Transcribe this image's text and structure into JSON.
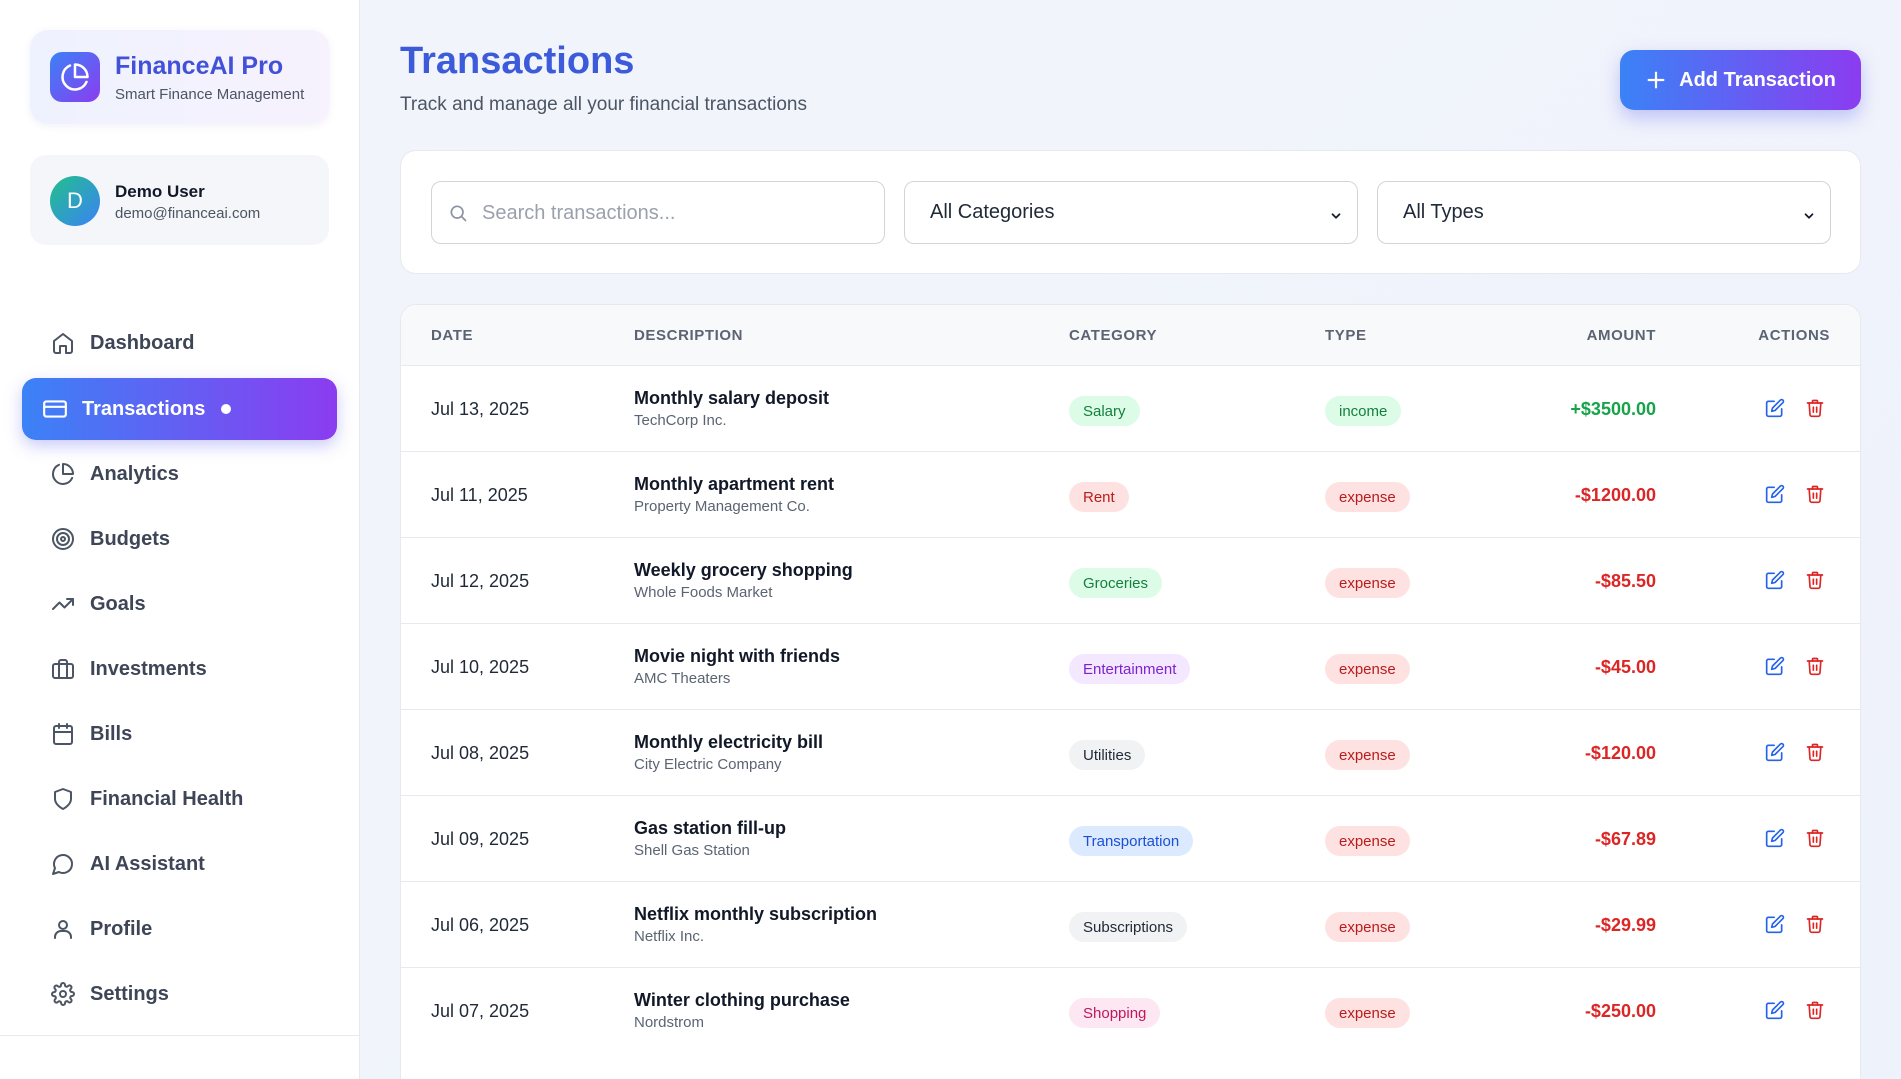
{
  "brand": {
    "title": "FinanceAI Pro",
    "subtitle": "Smart Finance Management"
  },
  "user": {
    "initial": "D",
    "name": "Demo User",
    "email": "demo@financeai.com"
  },
  "nav": [
    {
      "label": "Dashboard",
      "icon": "home-icon"
    },
    {
      "label": "Transactions",
      "icon": "credit-card-icon",
      "active": true
    },
    {
      "label": "Analytics",
      "icon": "pie-chart-icon"
    },
    {
      "label": "Budgets",
      "icon": "target-icon"
    },
    {
      "label": "Goals",
      "icon": "trending-up-icon"
    },
    {
      "label": "Investments",
      "icon": "briefcase-icon"
    },
    {
      "label": "Bills",
      "icon": "calendar-icon"
    },
    {
      "label": "Financial Health",
      "icon": "shield-icon"
    },
    {
      "label": "AI Assistant",
      "icon": "chat-bubble-icon"
    },
    {
      "label": "Profile",
      "icon": "user-icon"
    },
    {
      "label": "Settings",
      "icon": "gear-icon"
    }
  ],
  "header": {
    "title": "Transactions",
    "subtitle": "Track and manage all your financial transactions",
    "add_button": "Add Transaction"
  },
  "filters": {
    "search_placeholder": "Search transactions...",
    "category_selected": "All Categories",
    "type_selected": "All Types"
  },
  "table": {
    "columns": [
      "DATE",
      "DESCRIPTION",
      "CATEGORY",
      "TYPE",
      "AMOUNT",
      "ACTIONS"
    ],
    "rows": [
      {
        "date": "Jul 13, 2025",
        "description": "Monthly salary deposit",
        "merchant": "TechCorp Inc.",
        "category": "Salary",
        "type": "income",
        "amount": "+$3500.00"
      },
      {
        "date": "Jul 11, 2025",
        "description": "Monthly apartment rent",
        "merchant": "Property Management Co.",
        "category": "Rent",
        "type": "expense",
        "amount": "-$1200.00"
      },
      {
        "date": "Jul 12, 2025",
        "description": "Weekly grocery shopping",
        "merchant": "Whole Foods Market",
        "category": "Groceries",
        "type": "expense",
        "amount": "-$85.50"
      },
      {
        "date": "Jul 10, 2025",
        "description": "Movie night with friends",
        "merchant": "AMC Theaters",
        "category": "Entertainment",
        "type": "expense",
        "amount": "-$45.00"
      },
      {
        "date": "Jul 08, 2025",
        "description": "Monthly electricity bill",
        "merchant": "City Electric Company",
        "category": "Utilities",
        "type": "expense",
        "amount": "-$120.00"
      },
      {
        "date": "Jul 09, 2025",
        "description": "Gas station fill-up",
        "merchant": "Shell Gas Station",
        "category": "Transportation",
        "type": "expense",
        "amount": "-$67.89"
      },
      {
        "date": "Jul 06, 2025",
        "description": "Netflix monthly subscription",
        "merchant": "Netflix Inc.",
        "category": "Subscriptions",
        "type": "expense",
        "amount": "-$29.99"
      },
      {
        "date": "Jul 07, 2025",
        "description": "Winter clothing purchase",
        "merchant": "Nordstrom",
        "category": "Shopping",
        "type": "expense",
        "amount": "-$250.00"
      }
    ]
  },
  "colors": {
    "accent_start": "#3b82f6",
    "accent_end": "#8b3cf0",
    "income": "#16a34a",
    "expense": "#dc2626",
    "categories": {
      "Salary": {
        "bg": "#dcfce7",
        "fg": "#15803d"
      },
      "Rent": {
        "bg": "#fee2e2",
        "fg": "#b91c1c"
      },
      "Groceries": {
        "bg": "#dcfce7",
        "fg": "#15803d"
      },
      "Entertainment": {
        "bg": "#f3e8ff",
        "fg": "#7e22ce"
      },
      "Utilities": {
        "bg": "#f1f2f4",
        "fg": "#1f2937"
      },
      "Transportation": {
        "bg": "#dbeafe",
        "fg": "#1d4ed8"
      },
      "Subscriptions": {
        "bg": "#f1f2f4",
        "fg": "#1f2937"
      },
      "Shopping": {
        "bg": "#fce7f3",
        "fg": "#be185d"
      }
    },
    "types": {
      "income": {
        "bg": "#dcfce7",
        "fg": "#15803d"
      },
      "expense": {
        "bg": "#fee2e2",
        "fg": "#b91c1c"
      }
    }
  }
}
